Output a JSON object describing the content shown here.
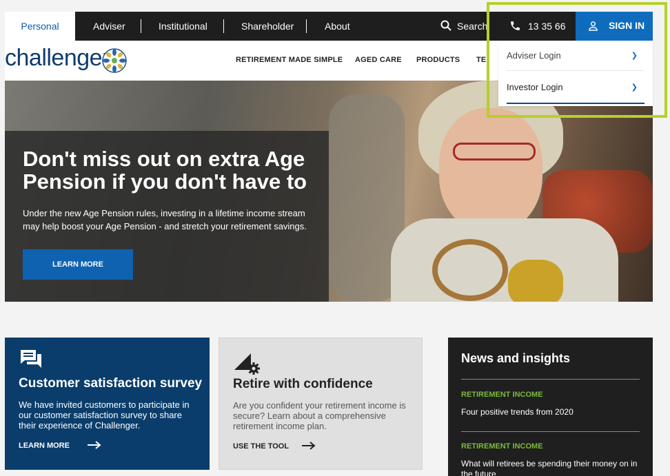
{
  "topbar": {
    "tabs": [
      "Personal",
      "Adviser",
      "Institutional",
      "Shareholder",
      "About"
    ],
    "search_label": "Search",
    "phone": "13 35 66",
    "signin_label": "SIGN IN"
  },
  "header": {
    "logo_text": "challenger",
    "nav": [
      "RETIREMENT MADE SIMPLE",
      "AGED CARE",
      "PRODUCTS",
      "TE"
    ]
  },
  "dropdown": {
    "items": [
      "Adviser Login",
      "Investor Login"
    ]
  },
  "hero": {
    "title": "Don't miss out on extra Age Pension if you don't have to",
    "subtitle": "Under the new Age Pension rules, investing in a lifetime income stream may help boost your Age Pension - and stretch your retirement savings.",
    "button": "LEARN MORE"
  },
  "cards": [
    {
      "title": "Customer satisfaction survey",
      "body": "We have invited customers to participate in our customer satisfaction survey to share their experience of Challenger.",
      "cta": "LEARN MORE"
    },
    {
      "title": "Retire with confidence",
      "body": "Are you confident your retirement income is secure? Learn about a comprehensive retirement income plan.",
      "cta": "USE THE TOOL"
    }
  ],
  "news": {
    "title": "News and insights",
    "items": [
      {
        "category": "RETIREMENT INCOME",
        "headline": "Four positive trends from 2020"
      },
      {
        "category": "RETIREMENT INCOME",
        "headline": "What will retirees be spending their money on in the future"
      }
    ]
  },
  "colors": {
    "brand_blue": "#0f6cbd",
    "navy": "#0a3d6b",
    "highlight": "#b6cf2b",
    "news_category": "#7dbb3a"
  }
}
